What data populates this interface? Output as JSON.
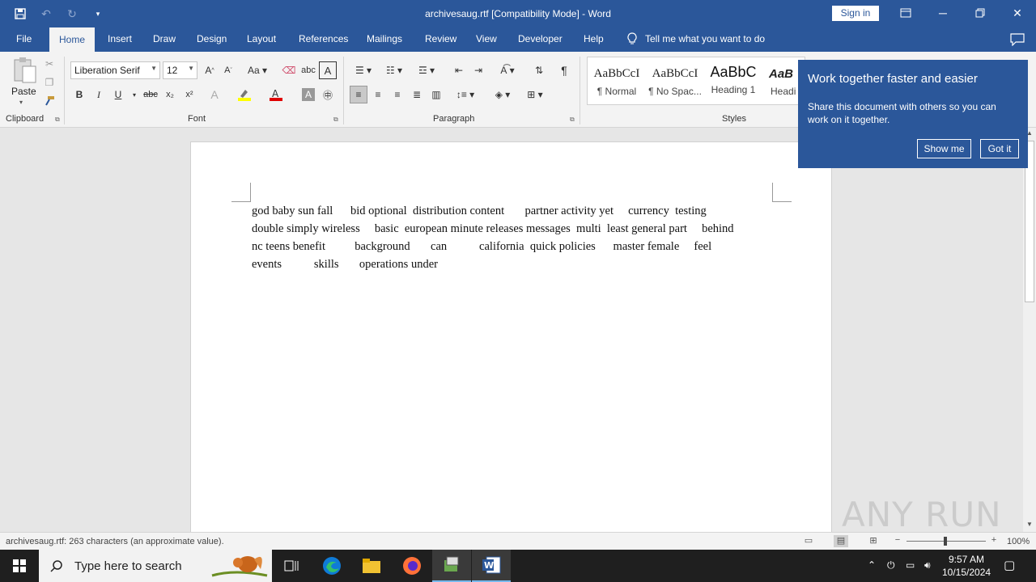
{
  "window": {
    "title": "archivesaug.rtf [Compatibility Mode]  -  Word",
    "sign_in": "Sign in"
  },
  "tabs": [
    "File",
    "Home",
    "Insert",
    "Draw",
    "Design",
    "Layout",
    "References",
    "Mailings",
    "Review",
    "View",
    "Developer",
    "Help"
  ],
  "tell_me": "Tell me what you want to do",
  "ribbon": {
    "clipboard": {
      "paste": "Paste",
      "label": "Clipboard"
    },
    "font": {
      "name": "Liberation Serif",
      "size": "12",
      "label": "Font"
    },
    "paragraph": {
      "label": "Paragraph"
    },
    "styles": {
      "label": "Styles",
      "items": [
        {
          "preview": "AaBbCcI",
          "name": "¶ Normal"
        },
        {
          "preview": "AaBbCcI",
          "name": "¶ No Spac..."
        },
        {
          "preview": "AaBbC",
          "name": "Heading 1"
        },
        {
          "preview": "AaB",
          "name": "Headi"
        }
      ]
    }
  },
  "document": {
    "text": "god baby sun fall      bid optional  distribution content       partner activity yet     currency  testing\ndouble simply wireless     basic  european minute releases messages  multi  least general part     behind\nnc teens benefit          background       can           california  quick policies      master female     feel\nevents           skills       operations under"
  },
  "callout": {
    "title": "Work together faster and easier",
    "body": "Share this document with others so you can work on it together.",
    "show_me": "Show me",
    "got_it": "Got it"
  },
  "statusbar": {
    "text": "archivesaug.rtf: 263 characters (an approximate value).",
    "zoom": "100%"
  },
  "taskbar": {
    "search_placeholder": "Type here to search",
    "time": "9:57 AM",
    "date": "10/15/2024"
  },
  "watermark": "ANY RUN",
  "colors": {
    "accent": "#2b579a"
  }
}
